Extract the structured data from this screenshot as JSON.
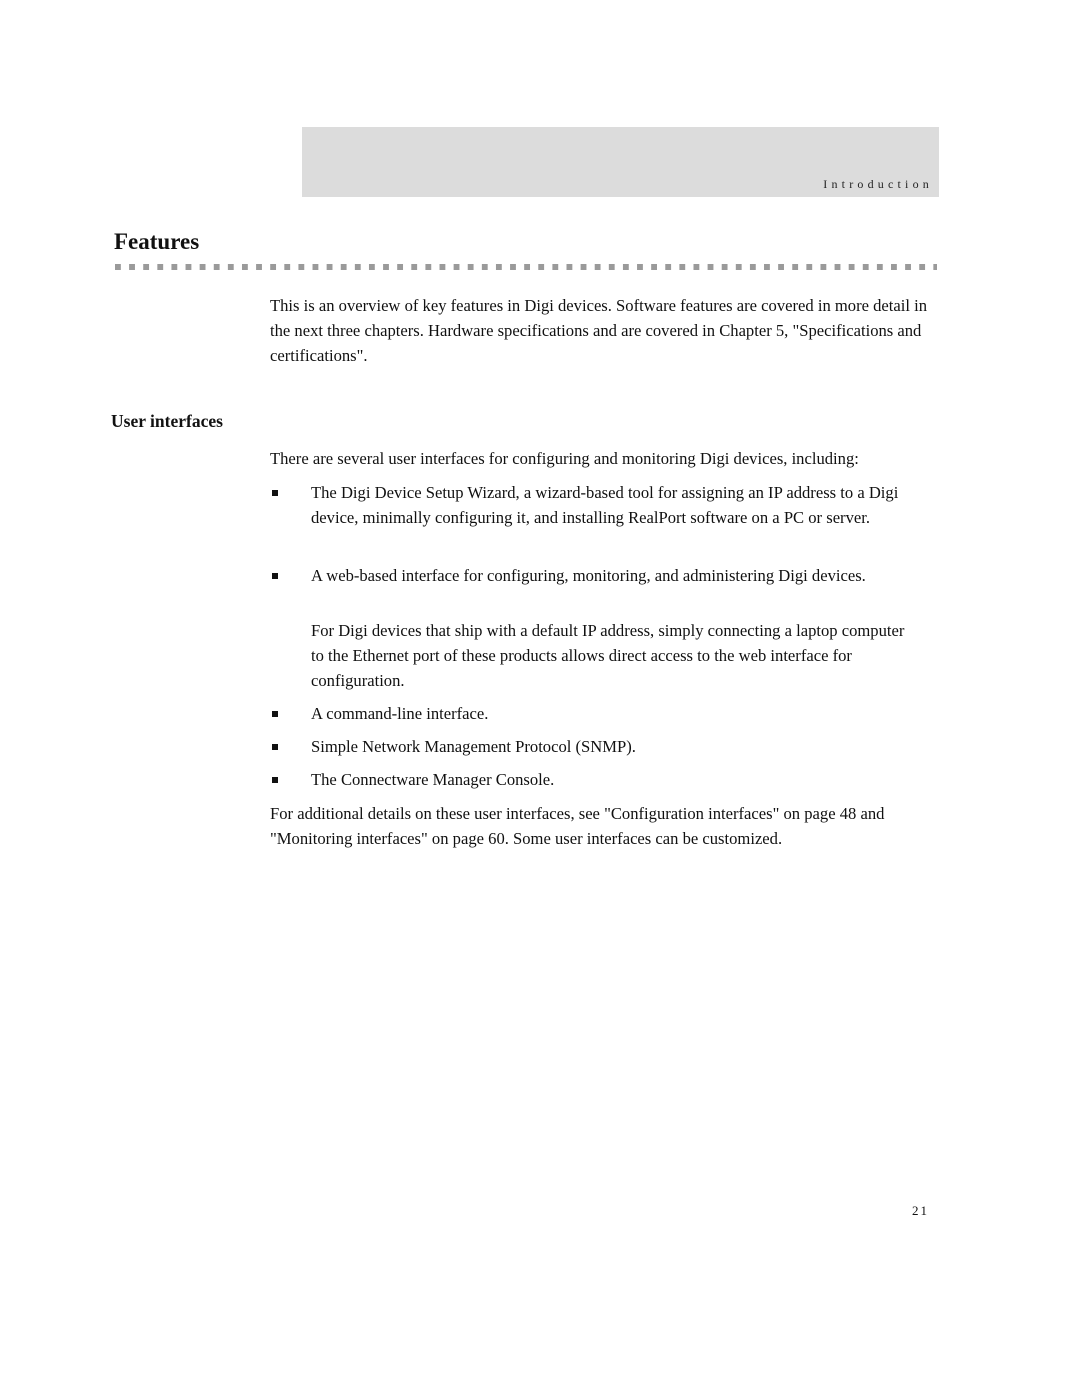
{
  "header": {
    "section_label": "Introduction"
  },
  "section": {
    "title": "Features",
    "intro": "This is an overview of key features in Digi devices. Software features are covered in more detail in the next three chapters. Hardware specifications and are covered in Chapter 5, \"Specifications and certifications\"."
  },
  "subsection": {
    "title": "User interfaces",
    "lead": "There are several user interfaces for configuring and monitoring Digi devices, including:",
    "bullets": [
      {
        "text": "The Digi Device Setup Wizard, a wizard-based tool for assigning an IP address to a Digi device, minimally configuring it, and installing RealPort software on a PC or server."
      },
      {
        "text": "A web-based interface for configuring, monitoring, and administering Digi devices.",
        "note": "For Digi devices that ship with a default IP address, simply connecting a laptop computer to the Ethernet port of these products allows direct access to the web interface for configuration."
      },
      {
        "text": "A command-line interface."
      },
      {
        "text": "Simple Network Management Protocol (SNMP)."
      },
      {
        "text": "The Connectware Manager Console."
      }
    ],
    "closing": "For additional details on these user interfaces, see \"Configuration interfaces\" on page 48 and \"Monitoring interfaces\" on page 60. Some user interfaces can be customized."
  },
  "footer": {
    "page_number": "21"
  }
}
